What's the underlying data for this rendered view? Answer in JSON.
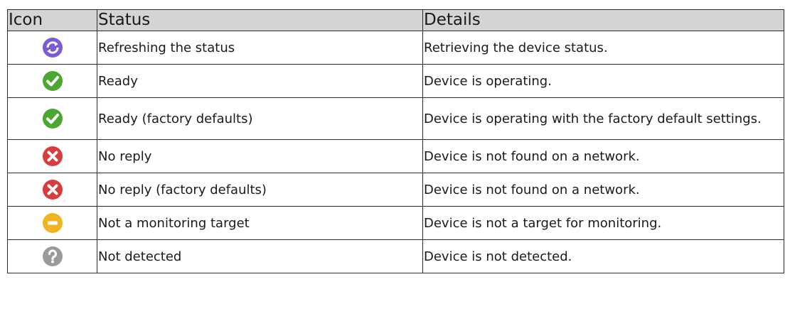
{
  "table": {
    "headers": {
      "icon": "Icon",
      "status": "Status",
      "details": "Details"
    },
    "rows": [
      {
        "icon": "refresh-icon",
        "icon_color": "#7a5ad6",
        "status": "Refreshing the status",
        "details": "Retrieving the device status."
      },
      {
        "icon": "checkmark-icon",
        "icon_color": "#4aa72f",
        "status": "Ready",
        "details": "Device is operating."
      },
      {
        "icon": "checkmark-icon",
        "icon_color": "#4aa72f",
        "status": "Ready (factory defaults)",
        "details": "Device is operating with the factory default settings."
      },
      {
        "icon": "cross-icon",
        "icon_color": "#d83c3c",
        "status": "No reply",
        "details": "Device is not found on a network."
      },
      {
        "icon": "cross-icon",
        "icon_color": "#d83c3c",
        "status": "No reply (factory defaults)",
        "details": "Device is not found on a network."
      },
      {
        "icon": "minus-icon",
        "icon_color": "#f2b321",
        "status": "Not a monitoring target",
        "details": "Device is not a target for monitoring."
      },
      {
        "icon": "question-icon",
        "icon_color": "#9a9a9a",
        "status": "Not detected",
        "details": "Device is not detected."
      }
    ]
  }
}
